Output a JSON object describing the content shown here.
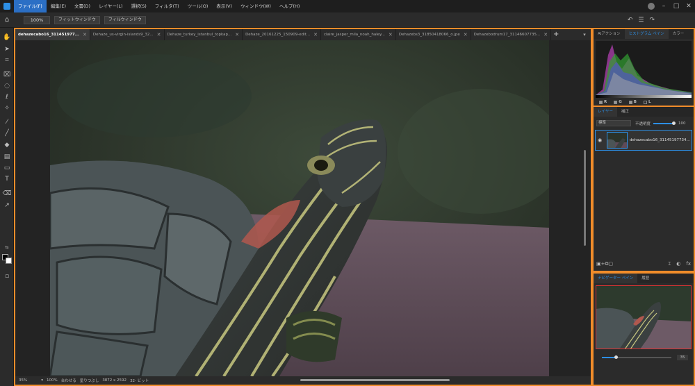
{
  "menu": {
    "items": [
      "ファイル(F)",
      "編集(E)",
      "文書(D)",
      "レイヤー(L)",
      "選択(S)",
      "フィルタ(T)",
      "ツール(O)",
      "表示(V)",
      "ウィンドウ(W)",
      "ヘルプ(H)"
    ],
    "active_index": 0
  },
  "options_bar": {
    "zoom": "100%",
    "fit_window": "フィットウィンドウ",
    "fill_window": "フィルウィンドウ"
  },
  "tabs": [
    {
      "label": "dehazecabo16_311451977...",
      "active": true
    },
    {
      "label": "Dehaze_us-virgin-islands9_32...",
      "active": false
    },
    {
      "label": "Dehaze_turkey_istanbul_topkap...",
      "active": false
    },
    {
      "label": "Dehaze_20161225_150909-edit...",
      "active": false
    },
    {
      "label": "claire_jasper_mila_noah_haley...",
      "active": false
    },
    {
      "label": "Dehazebs3_31850418066_o.jpe",
      "active": false
    },
    {
      "label": "Dehazebodrum17_31146607735...",
      "active": false
    }
  ],
  "status": {
    "zoom": "35%",
    "zoom_100": "100%",
    "fit": "合わせる",
    "fill": "塗りつぶし",
    "dimensions": "3872 x 2592",
    "bits": "32- ビット"
  },
  "right_panel": {
    "top_tabs": [
      {
        "label": "AIアクション",
        "active": false
      },
      {
        "label": "ヒストグラム ペイン",
        "active": true
      },
      {
        "label": "カラー",
        "active": false
      }
    ],
    "histogram_channels": [
      {
        "label": "R",
        "checked": true
      },
      {
        "label": "G",
        "checked": true
      },
      {
        "label": "B",
        "checked": true
      },
      {
        "label": "L",
        "checked": false
      }
    ],
    "layer_tabs": [
      {
        "label": "レイヤー",
        "active": true
      },
      {
        "label": "補正",
        "active": false
      }
    ],
    "blend_mode": "標準",
    "opacity_label": "不透明度",
    "opacity_value": "100",
    "layer_name": "dehazecabo16_31145197734...",
    "nav_tabs": [
      {
        "label": "ナビゲーター ペイン",
        "active": true
      },
      {
        "label": "履歴",
        "active": false
      }
    ],
    "nav_zoom_value": "35"
  },
  "colors": {
    "accent": "#2d8fe5",
    "highlight": "#f08c2a",
    "menu_active": "#2b6fc5"
  }
}
